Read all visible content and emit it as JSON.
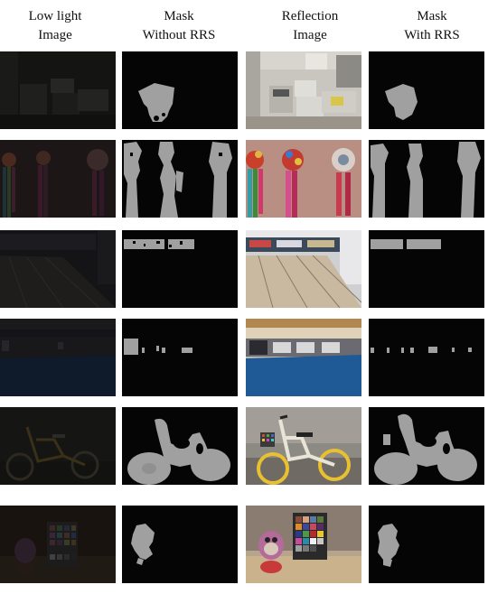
{
  "headers": [
    {
      "line1": "Low light",
      "line2": "Image"
    },
    {
      "line1": "Mask",
      "line2": "Without RRS"
    },
    {
      "line1": "Reflection",
      "line2": "Image"
    },
    {
      "line1": "Mask",
      "line2": "With RRS"
    }
  ],
  "rows": [
    {
      "scene": "office"
    },
    {
      "scene": "tassels"
    },
    {
      "scene": "bowling"
    },
    {
      "scene": "hall"
    },
    {
      "scene": "bicycle"
    },
    {
      "scene": "toy-colorchecker"
    }
  ]
}
